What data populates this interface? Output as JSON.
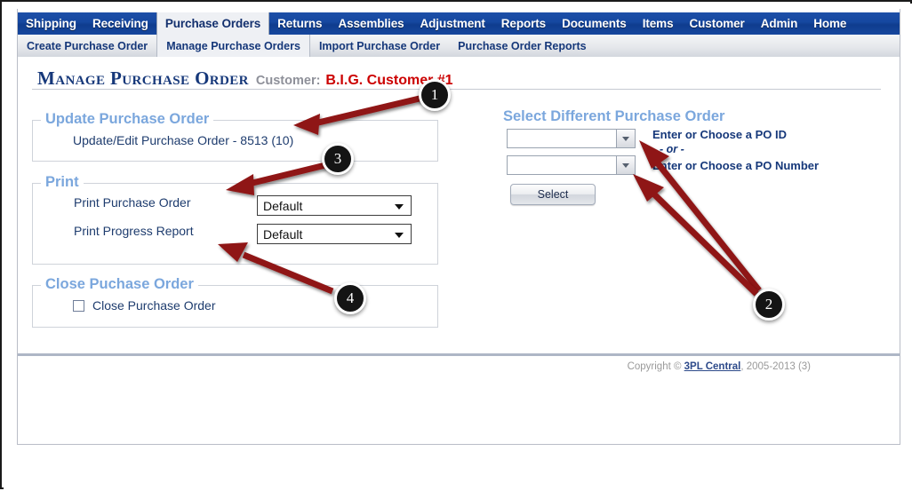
{
  "nav": {
    "main_items": [
      {
        "label": "Shipping",
        "active": false
      },
      {
        "label": "Receiving",
        "active": false
      },
      {
        "label": "Purchase Orders",
        "active": true
      },
      {
        "label": "Returns",
        "active": false
      },
      {
        "label": "Assemblies",
        "active": false
      },
      {
        "label": "Adjustment",
        "active": false
      },
      {
        "label": "Reports",
        "active": false
      },
      {
        "label": "Documents",
        "active": false
      },
      {
        "label": "Items",
        "active": false
      },
      {
        "label": "Customer",
        "active": false
      },
      {
        "label": "Admin",
        "active": false
      },
      {
        "label": "Home",
        "active": false
      }
    ],
    "sub_items": [
      {
        "label": "Create Purchase Order",
        "active": false
      },
      {
        "label": "Manage Purchase Orders",
        "active": true
      },
      {
        "label": "Import Purchase Order",
        "active": false
      },
      {
        "label": "Purchase Order Reports",
        "active": false
      }
    ]
  },
  "header": {
    "title": "Manage Purchase Order",
    "customer_label": "Customer:",
    "customer_name": "B.I.G. Customer #1"
  },
  "update_section": {
    "legend": "Update Purchase Order",
    "link": "Update/Edit Purchase Order - 8513 (10)"
  },
  "print_section": {
    "legend": "Print",
    "rows": [
      {
        "label": "Print Purchase Order",
        "value": "Default"
      },
      {
        "label": "Print Progress Report",
        "value": "Default"
      }
    ]
  },
  "close_section": {
    "legend": "Close Puchase Order",
    "checkbox_label": "Close Purchase Order",
    "checked": false
  },
  "select_panel": {
    "title": "Select Different Purchase Order",
    "po_id": {
      "value": "",
      "hint": "Enter or Choose a PO ID"
    },
    "or_text": "- or -",
    "po_number": {
      "value": "",
      "hint": "Enter or Choose a PO Number"
    },
    "select_button": "Select"
  },
  "footer": {
    "prefix": "Copyright © ",
    "link": "3PL Central",
    "suffix": ", 2005-2013 (3)"
  },
  "callouts": [
    {
      "number": "1"
    },
    {
      "number": "2"
    },
    {
      "number": "3"
    },
    {
      "number": "4"
    }
  ],
  "colors": {
    "nav_blue": "#16479e",
    "legend_blue": "#7ba7dd",
    "label_navy": "#1e3c6e",
    "customer_red": "#cc0000",
    "arrow_red": "#8f1414"
  }
}
